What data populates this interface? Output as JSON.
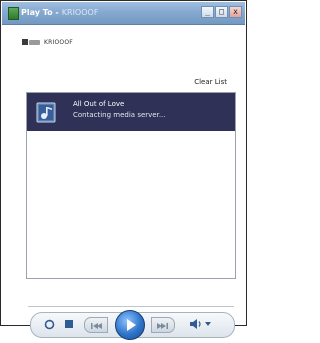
{
  "window": {
    "title": "Play To -",
    "title_device": "KRIOOOF",
    "minimize_glyph": "_",
    "maximize_glyph": "□",
    "close_glyph": "x"
  },
  "device": {
    "name": "KRIOOOF",
    "icon": "media-device-icon"
  },
  "toolbar": {
    "clear_list_label": "Clear List"
  },
  "playlist": {
    "items": [
      {
        "title": "All Out of Love",
        "status": "Contacting media server...",
        "icon": "music-file-icon",
        "selected": true
      }
    ]
  },
  "controls": {
    "repeat": "repeat-icon",
    "stop": "stop-icon",
    "previous": "previous-icon",
    "play": "play-icon",
    "next": "next-icon",
    "volume": "volume-icon",
    "accent_color": "#2e74c9",
    "selection_color": "#2f3156"
  }
}
